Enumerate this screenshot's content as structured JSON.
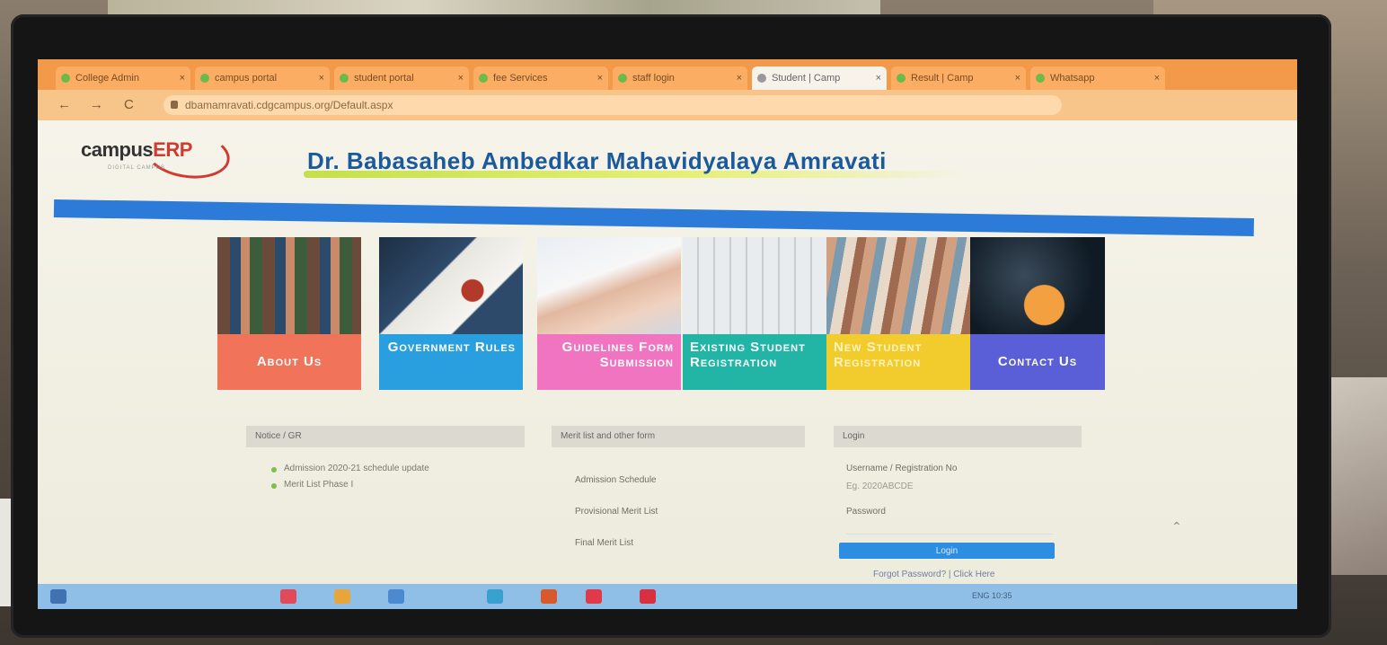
{
  "browser": {
    "tabs": [
      {
        "label": "College Admin"
      },
      {
        "label": "campus portal"
      },
      {
        "label": "student portal"
      },
      {
        "label": "fee Services"
      },
      {
        "label": "staff login"
      },
      {
        "label": "Student | Camp",
        "active": true
      },
      {
        "label": "Result | Camp"
      },
      {
        "label": "Whatsapp"
      }
    ],
    "nav": {
      "back": "←",
      "forward": "→",
      "reload": "C"
    },
    "url": "dbamamravati.cdgcampus.org/Default.aspx"
  },
  "site": {
    "logo_prefix": "campus",
    "logo_suffix": "ERP",
    "logo_tagline": "DIGITAL CAMPUS",
    "college_name": "Dr. Babasaheb Ambedkar Mahavidyalaya Amravati"
  },
  "tiles": [
    {
      "label": "About Us",
      "color": "#f0735a",
      "photo": "students-group"
    },
    {
      "label": "Government Rules",
      "color": "#2a9fe0",
      "photo": "gavel-documents"
    },
    {
      "label": "Guidelines Form Submission",
      "color": "#f074c0",
      "photo": "hand-writing"
    },
    {
      "label": "Existing Student Registration",
      "color": "#22b5a6",
      "photo": "keyboard-typing"
    },
    {
      "label": "New Student Registration",
      "color": "#f2cb2c",
      "photo": "students-exam"
    },
    {
      "label": "Contact Us",
      "color": "#5a5fd8",
      "photo": "contact-phone"
    }
  ],
  "sections": {
    "notice": {
      "title": "Notice / GR",
      "items": [
        "Admission 2020-21 schedule update",
        "Merit List Phase I"
      ]
    },
    "merit": {
      "title": "Merit list and other form",
      "links": [
        "Admission Schedule",
        "Provisional Merit List",
        "Final Merit List"
      ]
    },
    "login": {
      "title": "Login",
      "username_label": "Username / Registration No",
      "username_hint": "Eg. 2020ABCDE",
      "password_label": "Password",
      "button": "Login",
      "forgot": "Forgot Password? | Click Here"
    }
  },
  "taskbar": {
    "tray_text": "ENG 10:35"
  },
  "colors": {
    "tabbar": "#f39a4a",
    "header_bar": "#2d7bd9",
    "college_text": "#1a5a9b",
    "login_button": "#2d8de0",
    "taskbar": "#8fbfe6"
  }
}
